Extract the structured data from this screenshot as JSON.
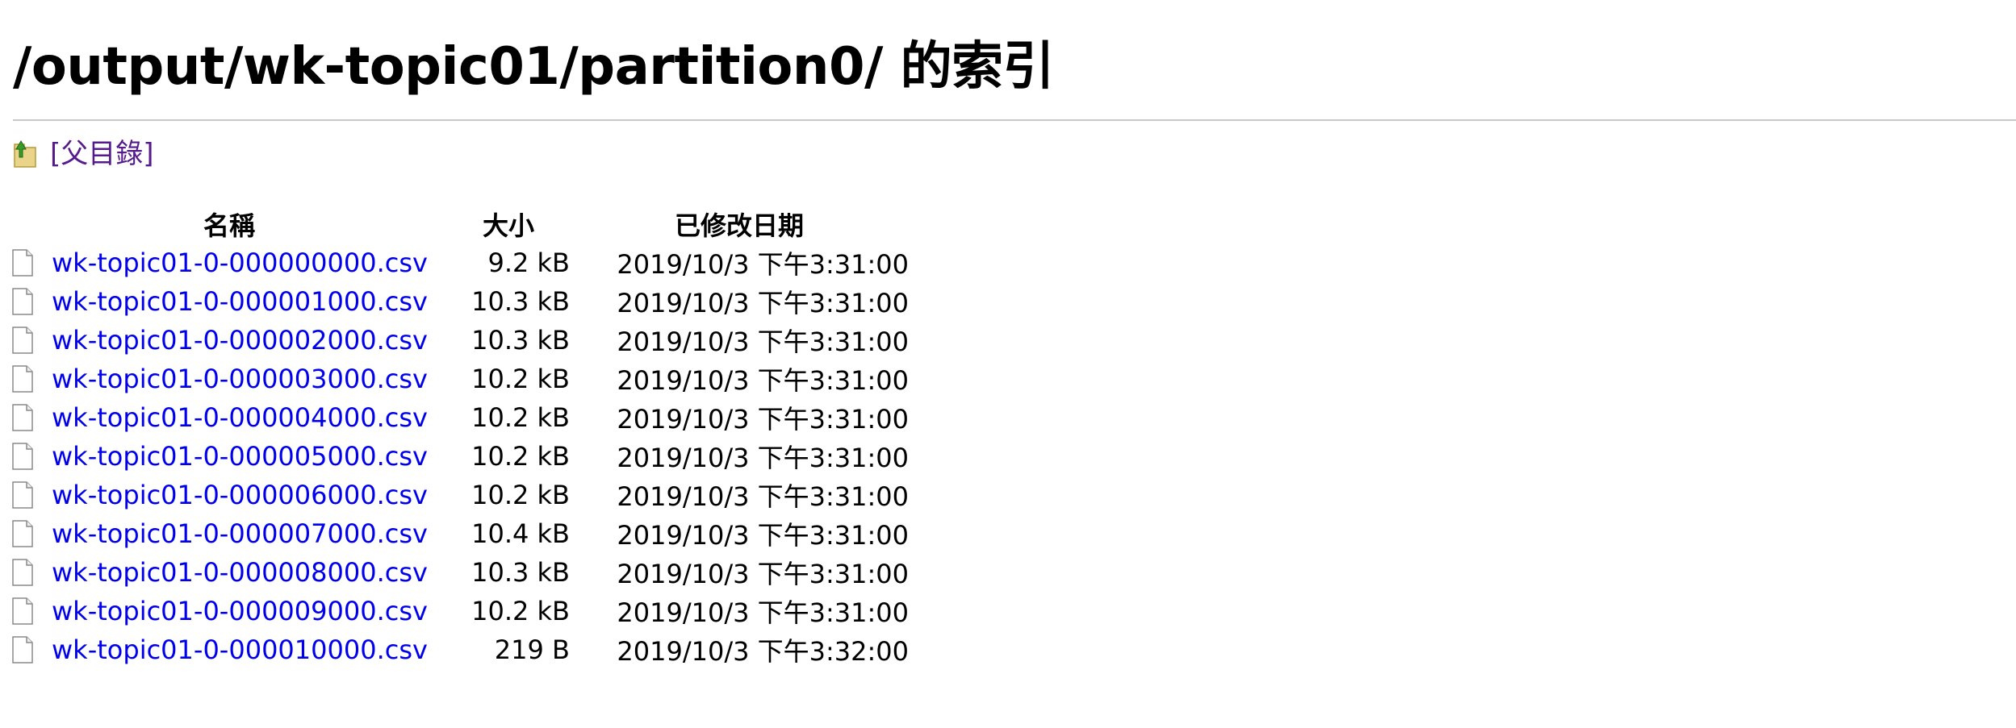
{
  "page": {
    "heading": "/output/wk-topic01/partition0/ 的索引"
  },
  "parent_link": {
    "label": "[父目錄]"
  },
  "table": {
    "headers": {
      "name": "名稱",
      "size": "大小",
      "modified": "已修改日期"
    },
    "rows": [
      {
        "name": "wk-topic01-0-000000000.csv",
        "size": "9.2 kB",
        "modified": "2019/10/3 下午3:31:00"
      },
      {
        "name": "wk-topic01-0-000001000.csv",
        "size": "10.3 kB",
        "modified": "2019/10/3 下午3:31:00"
      },
      {
        "name": "wk-topic01-0-000002000.csv",
        "size": "10.3 kB",
        "modified": "2019/10/3 下午3:31:00"
      },
      {
        "name": "wk-topic01-0-000003000.csv",
        "size": "10.2 kB",
        "modified": "2019/10/3 下午3:31:00"
      },
      {
        "name": "wk-topic01-0-000004000.csv",
        "size": "10.2 kB",
        "modified": "2019/10/3 下午3:31:00"
      },
      {
        "name": "wk-topic01-0-000005000.csv",
        "size": "10.2 kB",
        "modified": "2019/10/3 下午3:31:00"
      },
      {
        "name": "wk-topic01-0-000006000.csv",
        "size": "10.2 kB",
        "modified": "2019/10/3 下午3:31:00"
      },
      {
        "name": "wk-topic01-0-000007000.csv",
        "size": "10.4 kB",
        "modified": "2019/10/3 下午3:31:00"
      },
      {
        "name": "wk-topic01-0-000008000.csv",
        "size": "10.3 kB",
        "modified": "2019/10/3 下午3:31:00"
      },
      {
        "name": "wk-topic01-0-000009000.csv",
        "size": "10.2 kB",
        "modified": "2019/10/3 下午3:31:00"
      },
      {
        "name": "wk-topic01-0-000010000.csv",
        "size": "219 B",
        "modified": "2019/10/3 下午3:32:00"
      }
    ]
  },
  "icons": {
    "parent": "folder-up-icon",
    "file": "file-icon"
  },
  "colors": {
    "link": "#0000ee",
    "visited_link": "#551a8b",
    "rule": "#c8c8c8"
  }
}
